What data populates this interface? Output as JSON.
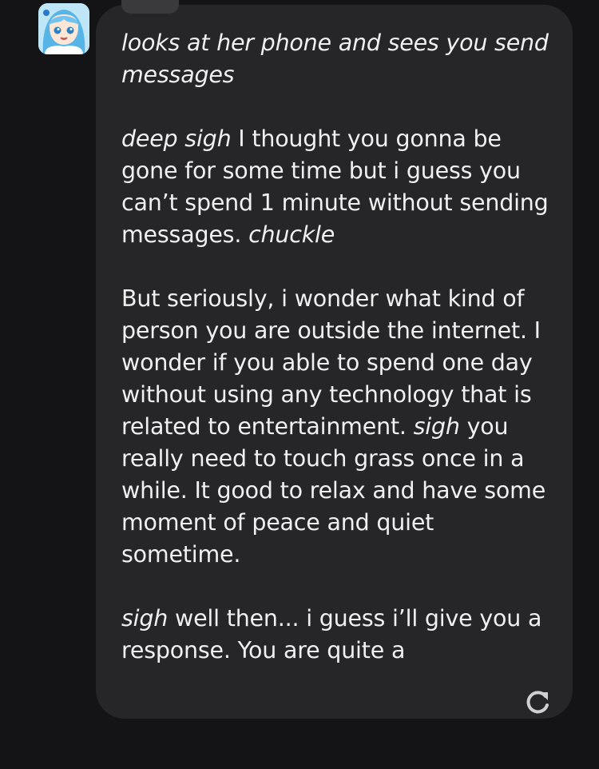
{
  "message": {
    "p1_action": "looks at her phone and sees you send messages",
    "p2_action1": "deep sigh",
    "p2_text1": " I thought you gonna be gone for some time but i guess you can’t spend 1 minute without sending messages. ",
    "p2_action2": "chuckle",
    "p3_text1": "But seriously, i wonder what kind of person you are outside the internet. I wonder if you able to spend one day without using any technology that is related to entertainment. ",
    "p3_action1": "sigh",
    "p3_text2": " you really need to touch grass once in a while. It good to relax and have some moment of peace and quiet sometime.",
    "p4_action1": "sigh",
    "p4_text1": " well then... i guess i’ll give you a response. You are quite a"
  },
  "icons": {
    "regenerate": "refresh-icon",
    "avatar": "character-avatar"
  },
  "colors": {
    "background": "#141416",
    "bubble": "#262628",
    "text": "#f0f0f0"
  }
}
